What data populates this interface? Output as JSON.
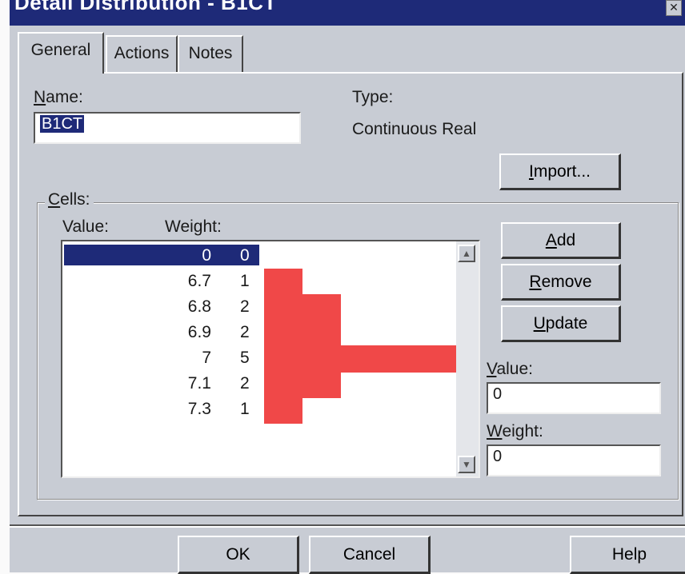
{
  "window": {
    "title": "Detail Distribution - B1CT",
    "close_glyph": "✕"
  },
  "tabs": [
    {
      "label": "General"
    },
    {
      "label": "Actions"
    },
    {
      "label": "Notes"
    }
  ],
  "general": {
    "name_label": "Name:",
    "name_value": "B1CT",
    "type_label": "Type:",
    "type_value": "Continuous Real",
    "import_label": "Import..."
  },
  "cells": {
    "legend": "Cells:",
    "value_header": "Value:",
    "weight_header": "Weight:",
    "rows": [
      {
        "value": "0",
        "weight": "0"
      },
      {
        "value": "6.7",
        "weight": "1"
      },
      {
        "value": "6.8",
        "weight": "2"
      },
      {
        "value": "6.9",
        "weight": "2"
      },
      {
        "value": "7",
        "weight": "5"
      },
      {
        "value": "7.1",
        "weight": "2"
      },
      {
        "value": "7.3",
        "weight": "1"
      }
    ],
    "selected_index": 0,
    "bar_color": "#f04848"
  },
  "side": {
    "add_label": "Add",
    "remove_label": "Remove",
    "update_label": "Update",
    "value_label": "Value:",
    "value_input": "0",
    "weight_label": "Weight:",
    "weight_input": "0"
  },
  "footer": {
    "ok_label": "OK",
    "cancel_label": "Cancel",
    "help_label": "Help"
  },
  "icons": {
    "scroll_up": "up-arrow-icon",
    "scroll_down": "down-arrow-icon"
  }
}
